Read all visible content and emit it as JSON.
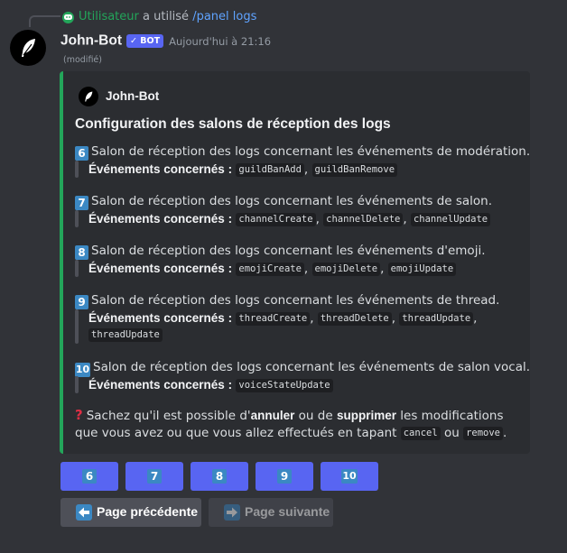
{
  "reply": {
    "user": "Utilisateur",
    "verb": "a utilisé",
    "command": "/panel logs"
  },
  "message": {
    "author": "John-Bot",
    "badge": "✓ BOT",
    "timestamp": "Aujourd'hui à 21:16",
    "edited": "(modifié)"
  },
  "embed": {
    "author": "John-Bot",
    "title": "Configuration des salons de réception des logs",
    "events_label": "Événements concernés :",
    "sections": [
      {
        "num": "6",
        "text": "Salon de réception des logs concernant les événements de modération.",
        "events": [
          "guildBanAdd",
          "guildBanRemove"
        ]
      },
      {
        "num": "7",
        "text": "Salon de réception des logs concernant les événements de salon.",
        "events": [
          "channelCreate",
          "channelDelete",
          "channelUpdate"
        ]
      },
      {
        "num": "8",
        "text": "Salon de réception des logs concernant les événements d'emoji.",
        "events": [
          "emojiCreate",
          "emojiDelete",
          "emojiUpdate"
        ]
      },
      {
        "num": "9",
        "text": "Salon de réception des logs concernant les événements de thread.",
        "events": [
          "threadCreate",
          "threadDelete",
          "threadUpdate",
          "threadUpdate"
        ]
      },
      {
        "num": "10",
        "text": "Salon de réception des logs concernant les événements de salon vocal.",
        "events": [
          "voiceStateUpdate"
        ]
      }
    ],
    "note": {
      "t1": "Sachez qu'il est possible d'",
      "b1": "annuler",
      "t2": " ou de ",
      "b2": "supprimer",
      "t3": " les modifications que vous avez ou que vous allez effectués en tapant ",
      "c1": "cancel",
      "t4": " ou ",
      "c2": "remove",
      "t5": "."
    }
  },
  "buttons": {
    "numbers": [
      "6",
      "7",
      "8",
      "9",
      "10"
    ],
    "prev": "Page précédente",
    "next": "Page suivante"
  },
  "colors": {
    "accent": "#5865f2",
    "embed_bar": "#23a55a",
    "keycap": "#3b88c3"
  },
  "icons": {
    "reply": "discord-logo-icon",
    "avatar": "feather-icon",
    "note": "question-mark-icon",
    "prev": "left-arrow-icon",
    "next": "right-arrow-icon"
  }
}
